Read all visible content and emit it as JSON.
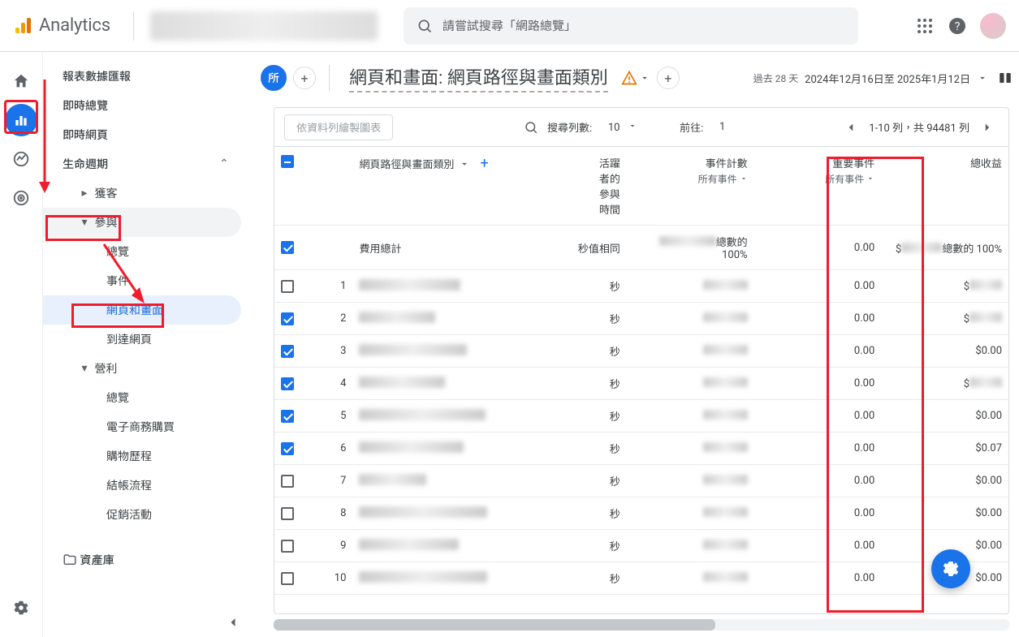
{
  "header": {
    "product": "Analytics",
    "search_placeholder": "請嘗試搜尋「網路總覽」"
  },
  "sidenav": {
    "top_link": "報表數據匯報",
    "realtime_overview": "即時總覽",
    "realtime_pages": "即時網頁",
    "lifecycle": "生命週期",
    "acquisition": "獲客",
    "engagement": "參與",
    "engagement_overview": "總覽",
    "events": "事件",
    "pages_and_screens": "網頁和畫面",
    "landing_page": "到達網頁",
    "monetization": "營利",
    "monetization_overview": "總覽",
    "ecommerce_purchases": "電子商務購買",
    "purchase_journey": "購物歷程",
    "checkout_journey": "結帳流程",
    "promotions": "促銷活動",
    "library": "資產庫"
  },
  "report": {
    "scope_label": "所",
    "title": "網頁和畫面: 網頁路徑與畫面類別",
    "date_label": "過去 28 天",
    "date_range": "2024年12月16日至 2025年1月12日"
  },
  "table": {
    "chart_disabled_btn": "依資料列繪製圖表",
    "rows_label_a": "搜尋列數:",
    "rows_value": "10",
    "goto_label": "前往:",
    "goto_value": "1",
    "pager_range": "1-10 列，共 94481 列",
    "dim_header": "網頁路徑與畫面類別",
    "metric2_line1": "活躍",
    "metric2_line2": "者的",
    "metric2_line3": "參與",
    "metric2_line4": "時間",
    "metric3": "事件計數",
    "metric3_sub": "所有事件",
    "metric4": "重要事件",
    "metric4_sub": "所有事件",
    "metric5": "總收益",
    "totals_label": "費用總計",
    "totals_sec_suffix": "秒",
    "totals_same": "值相同",
    "totals_pct": "總數的 100%",
    "rows": [
      {
        "idx": 1,
        "checked": false,
        "sec": "秒",
        "key_events": "0.00",
        "revenue": "$"
      },
      {
        "idx": 2,
        "checked": true,
        "sec": "秒",
        "key_events": "0.00",
        "revenue": "$"
      },
      {
        "idx": 3,
        "checked": true,
        "sec": "秒",
        "key_events": "0.00",
        "revenue": "$0.00"
      },
      {
        "idx": 4,
        "checked": true,
        "sec": "秒",
        "key_events": "0.00",
        "revenue": "$"
      },
      {
        "idx": 5,
        "checked": true,
        "sec": "秒",
        "key_events": "0.00",
        "revenue": "$0.00"
      },
      {
        "idx": 6,
        "checked": true,
        "sec": "秒",
        "key_events": "0.00",
        "revenue": "$0.07"
      },
      {
        "idx": 7,
        "checked": false,
        "sec": "秒",
        "key_events": "0.00",
        "revenue": "$0.00"
      },
      {
        "idx": 8,
        "checked": false,
        "sec": "秒",
        "key_events": "0.00",
        "revenue": "$0.00"
      },
      {
        "idx": 9,
        "checked": false,
        "sec": "秒",
        "key_events": "0.00",
        "revenue": "$0.00"
      },
      {
        "idx": 10,
        "checked": false,
        "sec": "秒",
        "key_events": "0.00",
        "revenue": "$0.00"
      }
    ],
    "totals": {
      "key_events": "0.00",
      "revenue_prefix": "$"
    }
  }
}
